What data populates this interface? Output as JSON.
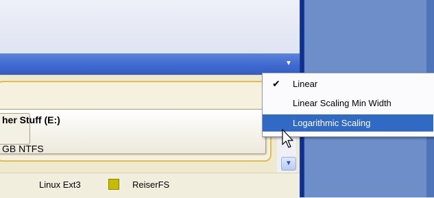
{
  "partition": {
    "name": "her Stuff (E:)",
    "info": "GB NTFS"
  },
  "legend": {
    "items": [
      {
        "label": "Linux Ext3"
      },
      {
        "label": "ReiserFS",
        "color": "#c8bc00"
      }
    ]
  },
  "menu": {
    "items": [
      {
        "label": "Linear",
        "checked": true,
        "check_glyph": "✔"
      },
      {
        "label": "Linear Scaling Min Width",
        "checked": false
      },
      {
        "label": "Logarithmic Scaling",
        "highlighted": true
      }
    ]
  },
  "icons": {
    "dropdown": "chevron-down-icon",
    "scroll_down": "scroll-down-icon",
    "cursor": "mouse-cursor-icon"
  },
  "colors": {
    "accent_blue": "#3f6ad0",
    "menu_highlight": "#316ac5",
    "frame_gold": "#e0bd52"
  }
}
